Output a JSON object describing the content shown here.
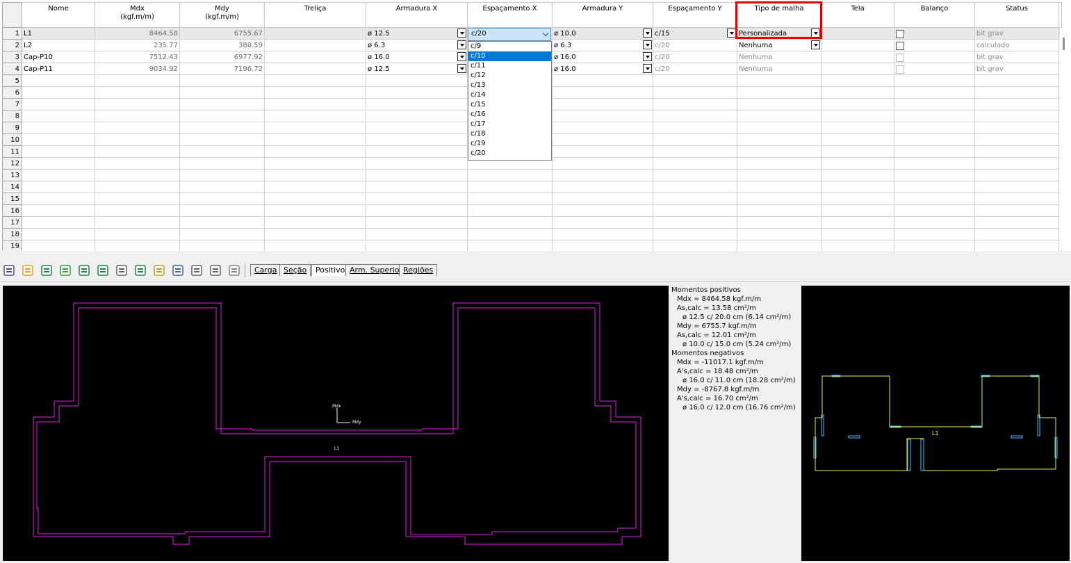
{
  "columns": [
    "Nome",
    "Mdx\n(kgf.m/m)",
    "Mdy\n(kgf.m/m)",
    "Treliça",
    "Armadura X",
    "Espaçamento X",
    "Armadura Y",
    "Espaçamento Y",
    "Tipo de malha",
    "Tela",
    "Balanço",
    "Status"
  ],
  "col_mdx": [
    "Mdx",
    "(kgf.m/m)"
  ],
  "col_mdy": [
    "Mdy",
    "(kgf.m/m)"
  ],
  "rows": [
    {
      "n": "1",
      "nome": "L1",
      "mdx": "8464.58",
      "mdy": "6755.67",
      "trelica": "",
      "armx": "ø 12.5",
      "espx": "c/20",
      "army": "ø 10.0",
      "espy": "c/15",
      "malha": "Personalizada",
      "tela": "",
      "status": "bit grav"
    },
    {
      "n": "2",
      "nome": "L2",
      "mdx": "235.77",
      "mdy": "380.59",
      "trelica": "",
      "armx": "ø 6.3",
      "espx": "",
      "army": "ø 6.3",
      "espy": "c/20",
      "malha": "Nenhuma",
      "tela": "",
      "status": "calculado"
    },
    {
      "n": "3",
      "nome": "Cap-P10",
      "mdx": "7512.43",
      "mdy": "6977.92",
      "trelica": "",
      "armx": "ø 16.0",
      "espx": "",
      "army": "ø 16.0",
      "espy": "c/20",
      "malha": "Nenhuma",
      "tela": "",
      "status": "bit grav"
    },
    {
      "n": "4",
      "nome": "Cap-P11",
      "mdx": "9034.92",
      "mdy": "7196.72",
      "trelica": "",
      "armx": "ø 12.5",
      "espx": "",
      "army": "ø 16.0",
      "espy": "c/20",
      "malha": "Nenhuma",
      "tela": "",
      "status": "bit grav"
    }
  ],
  "empty_rows": [
    "5",
    "6",
    "7",
    "8",
    "9",
    "10",
    "11",
    "12",
    "13",
    "14",
    "15",
    "16",
    "17",
    "18",
    "19"
  ],
  "combo_value": "c/20",
  "dropdown_options": [
    "c/9",
    "c/10",
    "c/11",
    "c/12",
    "c/13",
    "c/14",
    "c/15",
    "c/16",
    "c/17",
    "c/18",
    "c/19",
    "c/20"
  ],
  "dropdown_selected": "c/10",
  "tabs": [
    "Carga",
    "Seção",
    "Positivo",
    "Arm. Superior",
    "Regiões"
  ],
  "active_tab": "Positivo",
  "toolbar_icons": [
    "grid-icon",
    "lock-icon",
    "calculate-icon",
    "report-icon",
    "table-icon",
    "dimension-icon",
    "load-icon",
    "axis-icon",
    "mesh-icon",
    "measure-icon",
    "section-icon",
    "rebar-icon",
    "document-icon"
  ],
  "info": [
    "Momentos positivos",
    "Mdx = 8464.58 kgf.m/m",
    "As,calc = 13.58 cm²/m",
    "ø 12.5 c/ 20.0 cm (6.14 cm²/m)",
    "Mdy = 6755.7 kgf.m/m",
    "As,calc = 12.01 cm²/m",
    "ø 10.0 c/ 15.0 cm (5.24 cm²/m)",
    "Momentos negativos",
    "Mdx = -11017.1 kgf.m/m",
    "A's,calc = 18.48 cm²/m",
    "ø 16.0 c/ 11.0 cm (18.28 cm²/m)",
    "Mdy = -8767.8 kgf.m/m",
    "A's,calc = 16.70 cm²/m",
    "ø 16.0 c/ 12.0 cm (16.76 cm²/m)"
  ],
  "canvas": {
    "axis_x_label": "Mdy",
    "axis_y_label": "Mdx",
    "slab_label": "L1",
    "preview_label": "L1"
  },
  "colors": {
    "outline": "#e020e0",
    "preview_yellow": "#f0f040",
    "preview_cyan": "#40c0ff",
    "highlight": "#0078d7",
    "red_box": "#e00000"
  }
}
